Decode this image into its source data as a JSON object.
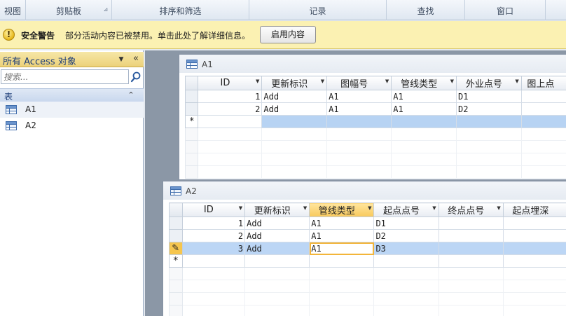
{
  "ribbon": {
    "groups": [
      {
        "label": "视图"
      },
      {
        "label": "剪贴板"
      },
      {
        "label": "排序和筛选"
      },
      {
        "label": "记录"
      },
      {
        "label": "查找"
      },
      {
        "label": "窗口"
      }
    ]
  },
  "security_bar": {
    "title": "安全警告",
    "message": "部分活动内容已被禁用。单击此处了解详细信息。",
    "button_label": "启用内容",
    "icon": "warning-shield-icon",
    "background": "#fbf1b2"
  },
  "nav_pane": {
    "header": "所有 Access 对象",
    "search_placeholder": "搜索...",
    "group_label": "表",
    "items": [
      {
        "label": "A1"
      },
      {
        "label": "A2"
      }
    ]
  },
  "table_a1": {
    "title": "A1",
    "columns": [
      "ID",
      "更新标识",
      "图幅号",
      "管线类型",
      "外业点号",
      "图上点"
    ],
    "rows": [
      {
        "selector": "",
        "cells": [
          "1",
          "Add",
          "A1",
          "A1",
          "D1",
          ""
        ]
      },
      {
        "selector": "",
        "cells": [
          "2",
          "Add",
          "A1",
          "A1",
          "D2",
          ""
        ]
      }
    ],
    "new_row_marker": "*"
  },
  "table_a2": {
    "title": "A2",
    "columns": [
      "ID",
      "更新标识",
      "管线类型",
      "起点点号",
      "终点点号",
      "起点埋深"
    ],
    "selected_column": "管线类型",
    "rows": [
      {
        "selector": "",
        "cells": [
          "1",
          "Add",
          "A1",
          "D1",
          "",
          ""
        ]
      },
      {
        "selector": "",
        "cells": [
          "2",
          "Add",
          "A1",
          "D2",
          "",
          ""
        ]
      },
      {
        "selector": "✎",
        "cells": [
          "3",
          "Add",
          "A1",
          "D3",
          "",
          ""
        ]
      }
    ],
    "new_row_marker": "*"
  },
  "colors": {
    "accent_selection": "#bcd6f5",
    "active_cell_border": "#f3b53a",
    "nav_header": "#ecd27a"
  }
}
